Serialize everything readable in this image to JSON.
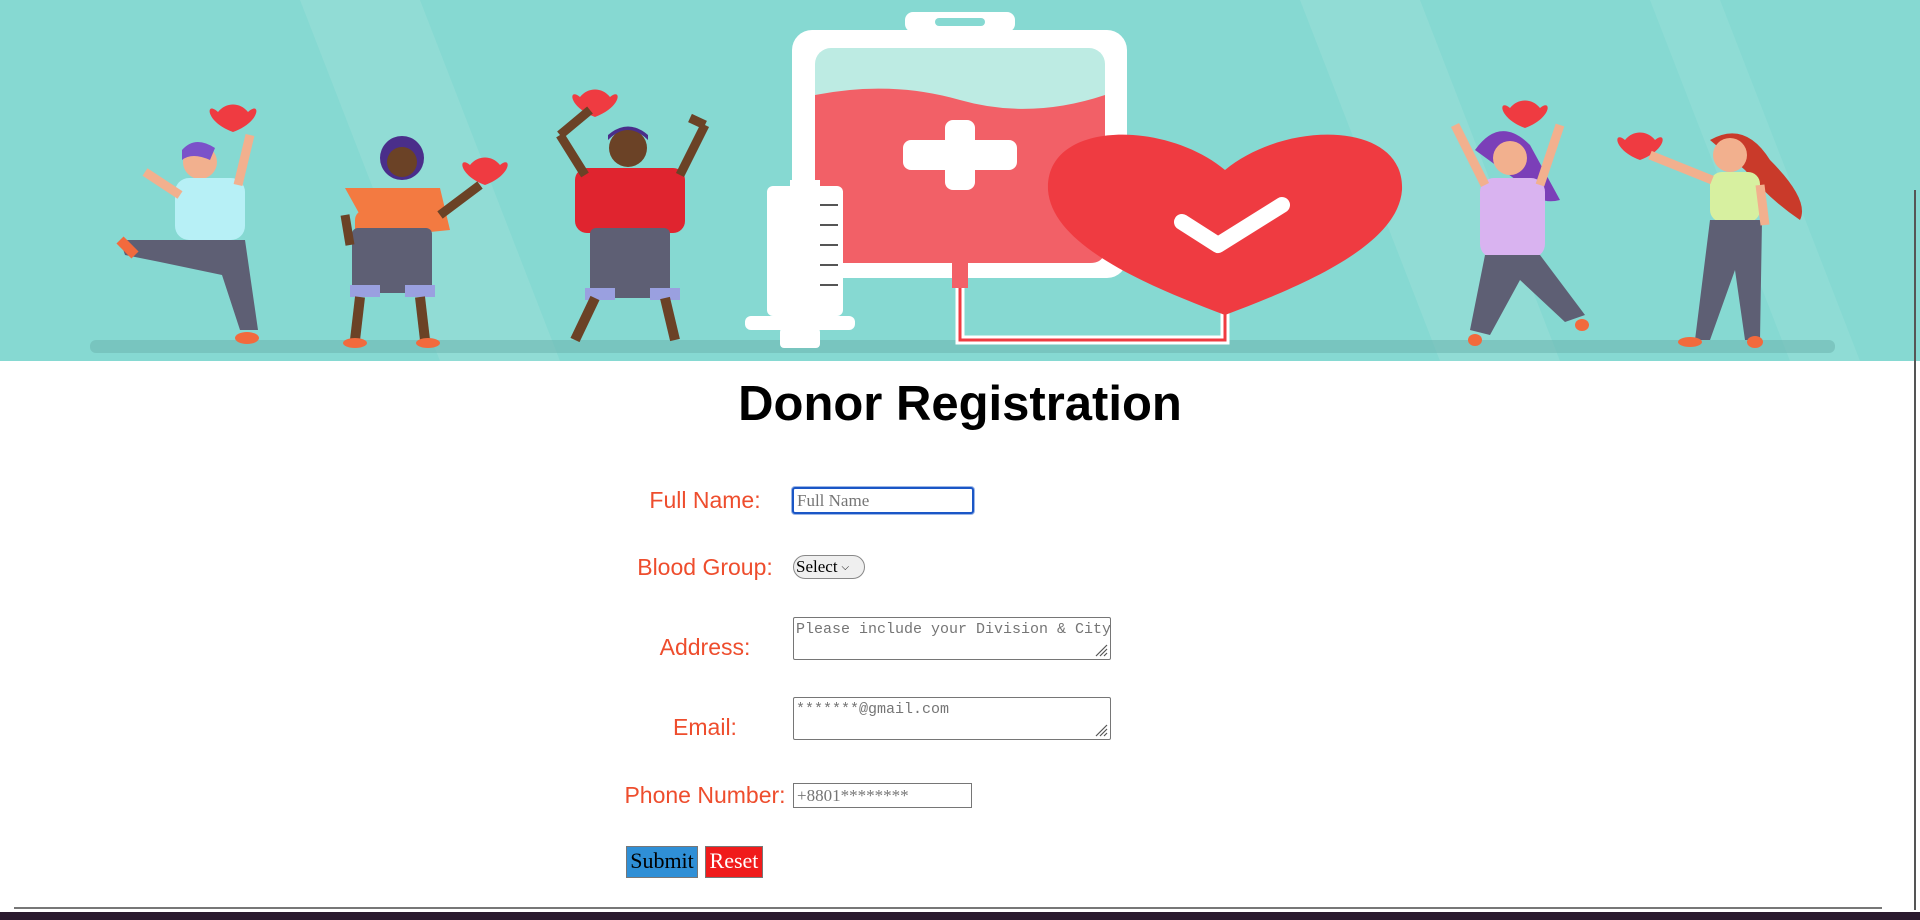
{
  "page": {
    "title": "Donor Registration"
  },
  "form": {
    "full_name": {
      "label": "Full Name:",
      "placeholder": "Full Name",
      "value": ""
    },
    "blood_group": {
      "label": "Blood Group:",
      "selected": "Select"
    },
    "address": {
      "label": "Address:",
      "placeholder": "Please include your Division & City"
    },
    "email": {
      "label": "Email:",
      "placeholder": "*******@gmail.com"
    },
    "phone": {
      "label": "Phone Number:",
      "placeholder": "+8801********"
    },
    "submit_label": "Submit",
    "reset_label": "Reset"
  },
  "colors": {
    "banner_bg": "#86d9d2",
    "label_color": "#ee4d2d",
    "submit_bg": "#2f8fd6",
    "reset_bg": "#f01b1b"
  },
  "banner": {
    "illustration": "blood-donation-illustration",
    "icons": [
      "blood-bag-icon",
      "syringe-icon",
      "heart-check-icon",
      "heart-icon"
    ]
  }
}
